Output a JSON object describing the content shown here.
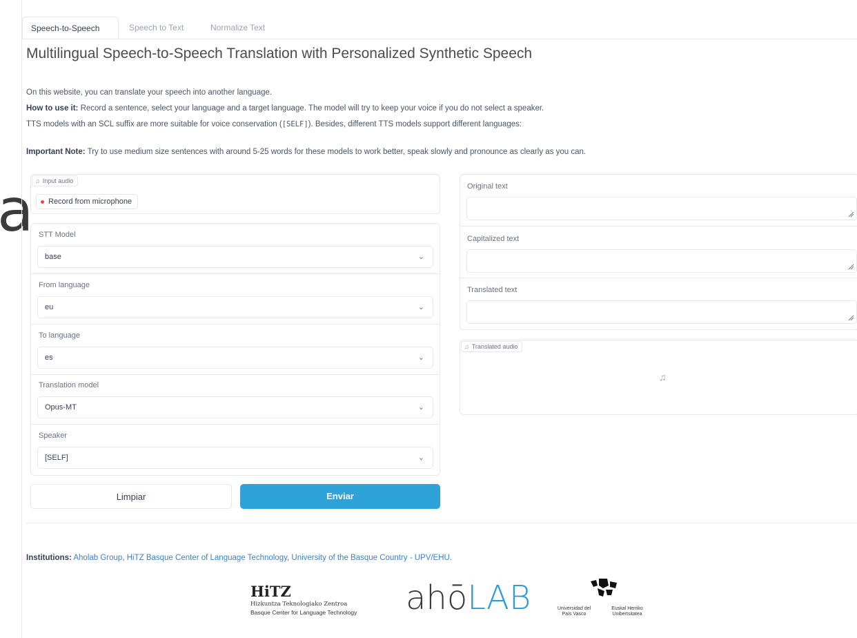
{
  "background_glyph": "a",
  "tabs": [
    {
      "label": "Speech-to-Speech",
      "active": true
    },
    {
      "label": "Speech to Text",
      "active": false
    },
    {
      "label": "Normalize Text",
      "active": false
    }
  ],
  "title": "Multilingual Speech-to-Speech Translation with Personalized Synthetic Speech",
  "description": {
    "line1": "On this website, you can translate your speech into another language.",
    "line2_bold": "How to use it:",
    "line2_rest": " Record a sentence, select your language and a target language. The model will try to keep your voice if you do not select a speaker.",
    "line3_pre": "TTS models with an SCL suffix are more suitable for voice conservation (",
    "line3_code": "[SELF]",
    "line3_post": "). Besides, different TTS models support different languages:",
    "note_bold": "Important Note:",
    "note_rest": " Try to use medium size sentences with around 5-25 words for these models to work better, speak slowly and pronounce as clearly as you can."
  },
  "input_audio": {
    "label": "Input audio",
    "record_label": "Record from microphone"
  },
  "fields": {
    "stt_model": {
      "label": "STT Model",
      "value": "base"
    },
    "from_language": {
      "label": "From language",
      "value": "eu"
    },
    "to_language": {
      "label": "To language",
      "value": "es"
    },
    "translation_model": {
      "label": "Translation model",
      "value": "Opus-MT"
    },
    "speaker": {
      "label": "Speaker",
      "value": "[SELF]"
    }
  },
  "outputs": {
    "original_text": {
      "label": "Original text",
      "value": ""
    },
    "capitalized_text": {
      "label": "Capitalized text",
      "value": ""
    },
    "translated_text": {
      "label": "Translated text",
      "value": ""
    },
    "translated_audio": {
      "label": "Translated audio"
    }
  },
  "buttons": {
    "clear": "Limpiar",
    "submit": "Enviar"
  },
  "institutions": {
    "label": "Institutions:",
    "links": [
      "Aholab Group",
      "HiTZ Basque Center of Language Technology",
      "University of the Basque Country - UPV/EHU."
    ]
  },
  "logos": {
    "hitz_title": "HiTZ",
    "hitz_sub1": "Hizkuntza Teknologiako Zentroa",
    "hitz_sub2": "Basque Center for Language Technology",
    "aholab_part1": "ahō",
    "aholab_part2": "LAB",
    "upv_left": "Universidad del País Vasco",
    "upv_right": "Euskal Herriko Unibertsitatea"
  },
  "icons": {
    "music_note": "music-note-icon",
    "chevron": "chevron-down-icon",
    "record_dot": "record-dot-icon"
  },
  "colors": {
    "primary": "#2ea3d9",
    "link": "#3b82c4",
    "record": "#ef4444"
  }
}
